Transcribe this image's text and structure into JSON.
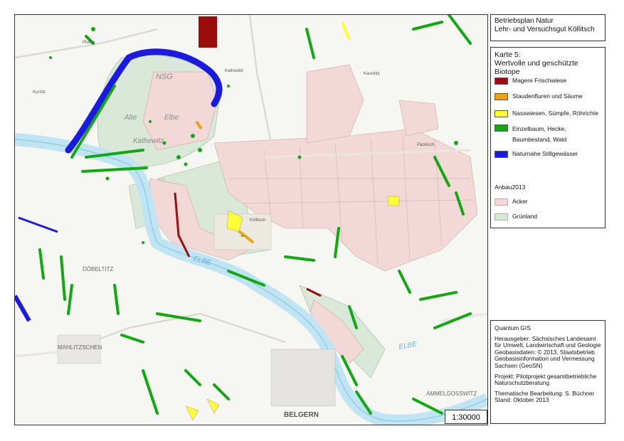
{
  "title": {
    "line1": "Betriebsplan Natur",
    "line2": "Lehr- und Versuchsgut Köllitsch"
  },
  "legend": {
    "map_title_line1": "Karte 5:",
    "map_title_line2": "Wertvolle und geschützte Biotope",
    "items": [
      {
        "label": "Magere Frischwiese",
        "color": "#9b0d0d"
      },
      {
        "label": "Staudenfluren und Säume",
        "color": "#f0a20e"
      },
      {
        "label": "Nasswiesen, Sümpfe, Röhrichte",
        "color": "#ffff33"
      },
      {
        "label": "Einzelbaum, Hecke,",
        "label2": "Baumbestand, Wald",
        "color": "#12a812"
      },
      {
        "label": "Naturnahe Stillgewässer",
        "color": "#1a1ae0"
      }
    ],
    "anbau_title": "Anbau2013",
    "anbau_items": [
      {
        "label": "Acker",
        "color": "#f2d9d7"
      },
      {
        "label": "Grünland",
        "color": "#d9e8d8"
      }
    ]
  },
  "info": {
    "software": "Quantum GIS",
    "publisher": "Herausgeber: Sächsisches Landesamt für Umwelt, Landwirtschaft und Geologie Geobasisdaten: © 2013, Staatsbetrieb Geobasisinformation und Vermessung Sachsen (GeoSN)",
    "project": "Projekt: Pilotprojekt gesamtbetriebliche Naturschutzberatung",
    "editor": "Thematische Bearbeitung: S. Büchner",
    "date": "Stand: Oktober 2013"
  },
  "scale": "1:30000",
  "map_labels": {
    "nsg": "NSG",
    "alte": "Alte",
    "elbe": "Elbe",
    "kathewitz": "Kathewitz",
    "kathewitz_top": "Kathewitz",
    "doebeltitz": "DÖBELTITZ",
    "mahlitzschen": "MAHLITZSCHEN",
    "belgern": "BELGERN",
    "ammelgosswitz": "AMMELGOSSWITZ",
    "kauckitz": "Kauckitz",
    "packisch": "Packisch",
    "koellitsch": "Köllitsch",
    "elbe_river": "ELBE",
    "elbe_river2": "ELBE",
    "kurzitz": "Kurzitz",
    "plotha": "Plotha"
  }
}
